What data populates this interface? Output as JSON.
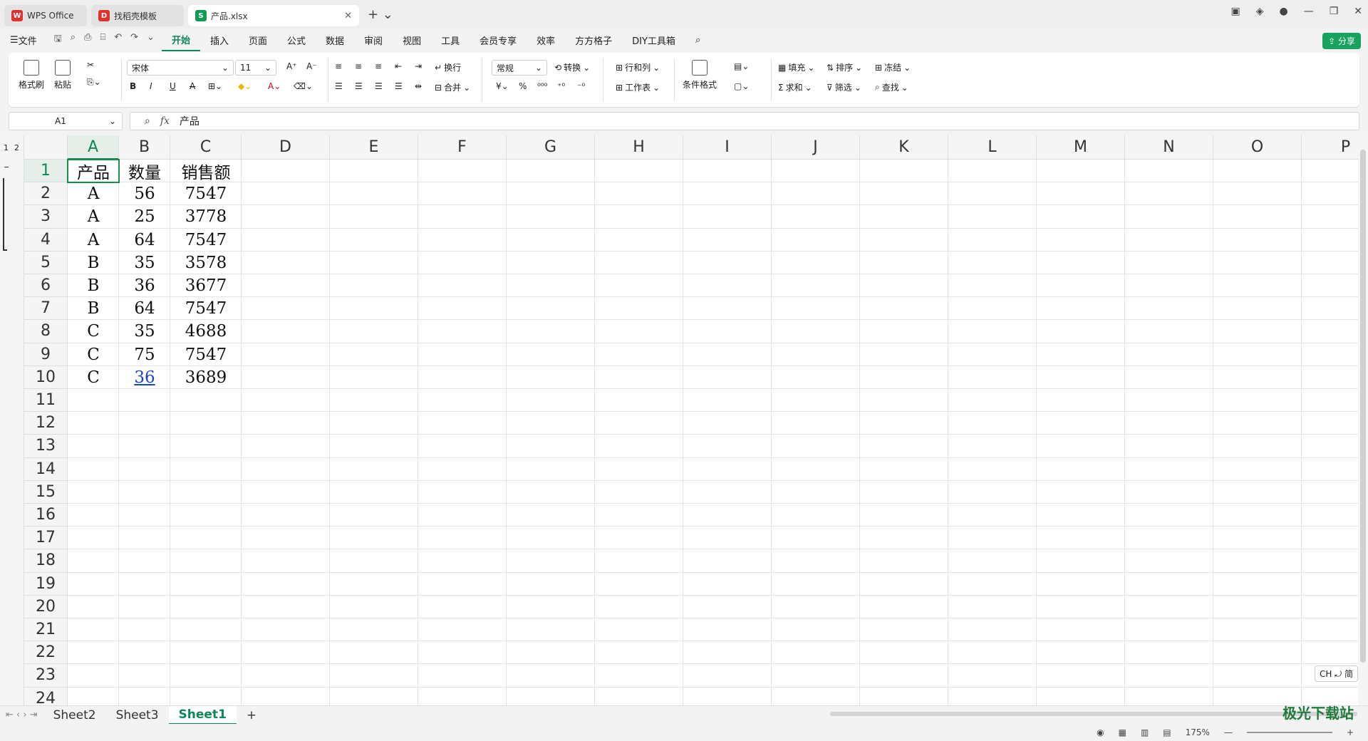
{
  "tabs": [
    {
      "label": "WPS Office",
      "active": false
    },
    {
      "label": "找稻壳模板",
      "active": false
    },
    {
      "label": "产品.xlsx",
      "active": true
    }
  ],
  "menu": {
    "file": "文件",
    "items": [
      "开始",
      "插入",
      "页面",
      "公式",
      "数据",
      "审阅",
      "视图",
      "工具",
      "会员专享",
      "效率",
      "方方格子",
      "DIY工具箱"
    ],
    "active": "开始",
    "share": "分享"
  },
  "ribbon": {
    "format_painter": "格式刷",
    "paste": "粘贴",
    "font_name": "宋体",
    "font_size": "11",
    "wrap": "换行",
    "number_format": "常规",
    "convert": "转换",
    "row_col": "行和列",
    "merge": "合并",
    "worksheet": "工作表",
    "cond_format": "条件格式",
    "fill": "填充",
    "sort": "排序",
    "freeze": "冻结",
    "sum": "求和",
    "filter": "筛选",
    "find": "查找"
  },
  "formula": {
    "cell_ref": "A1",
    "fx": "fx",
    "content": "产品"
  },
  "columns": [
    "A",
    "B",
    "C",
    "D",
    "E",
    "F",
    "G",
    "H",
    "I",
    "J",
    "K",
    "L",
    "M",
    "N",
    "O",
    "P"
  ],
  "rows": [
    "1",
    "2",
    "3",
    "4",
    "5",
    "6",
    "7",
    "8",
    "9",
    "10",
    "11",
    "12",
    "13",
    "14",
    "15",
    "16",
    "17",
    "18",
    "19",
    "20",
    "21",
    "22",
    "23",
    "24"
  ],
  "outline_levels": [
    "1",
    "2"
  ],
  "table": {
    "headers": [
      "产品",
      "数量",
      "销售额"
    ],
    "rows": [
      [
        "A",
        "56",
        "7547"
      ],
      [
        "A",
        "25",
        "3778"
      ],
      [
        "A",
        "64",
        "7547"
      ],
      [
        "B",
        "35",
        "3578"
      ],
      [
        "B",
        "36",
        "3677"
      ],
      [
        "B",
        "64",
        "7547"
      ],
      [
        "C",
        "35",
        "4688"
      ],
      [
        "C",
        "75",
        "7547"
      ],
      [
        "C",
        "36",
        "3689"
      ]
    ]
  },
  "sheets": [
    "Sheet2",
    "Sheet3",
    "Sheet1"
  ],
  "active_sheet": "Sheet1",
  "status": {
    "zoom": "175%"
  },
  "ime": "CH ⤾ 简",
  "watermark": "极光下载站"
}
